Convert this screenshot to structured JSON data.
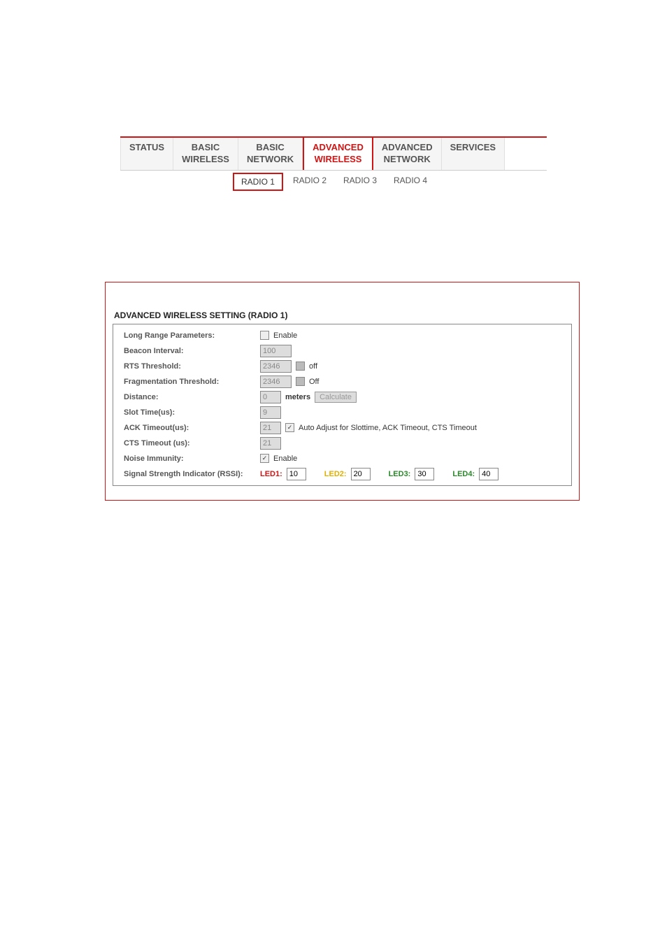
{
  "mainTabs": {
    "status": "STATUS",
    "basicWireless": "BASIC\nWIRELESS",
    "basicNetwork": "BASIC\nNETWORK",
    "advancedWireless": "ADVANCED\nWIRELESS",
    "advancedNetwork": "ADVANCED\nNETWORK",
    "services": "SERVICES"
  },
  "subTabs": {
    "radio1": "RADIO 1",
    "radio2": "RADIO 2",
    "radio3": "RADIO 3",
    "radio4": "RADIO 4"
  },
  "panel": {
    "title": "ADVANCED WIRELESS SETTING (RADIO 1)",
    "rows": {
      "longRange": {
        "label": "Long Range Parameters:",
        "enableText": "Enable"
      },
      "beacon": {
        "label": "Beacon Interval:",
        "value": "100"
      },
      "rts": {
        "label": "RTS Threshold:",
        "value": "2346",
        "offText": "off"
      },
      "frag": {
        "label": "Fragmentation Threshold:",
        "value": "2346",
        "offText": "Off"
      },
      "distance": {
        "label": "Distance:",
        "value": "0",
        "unit": "meters",
        "btn": "Calculate"
      },
      "slot": {
        "label": "Slot Time(us):",
        "value": "9"
      },
      "ack": {
        "label": "ACK Timeout(us):",
        "value": "21",
        "autoText": "Auto Adjust for Slottime, ACK Timeout, CTS Timeout"
      },
      "cts": {
        "label": "CTS Timeout (us):",
        "value": "21"
      },
      "noise": {
        "label": "Noise Immunity:",
        "enableText": "Enable"
      },
      "rssi": {
        "label": "Signal Strength Indicator (RSSI):",
        "led1label": "LED1:",
        "led1": "10",
        "led2label": "LED2:",
        "led2": "20",
        "led3label": "LED3:",
        "led3": "30",
        "led4label": "LED4:",
        "led4": "40"
      }
    }
  }
}
